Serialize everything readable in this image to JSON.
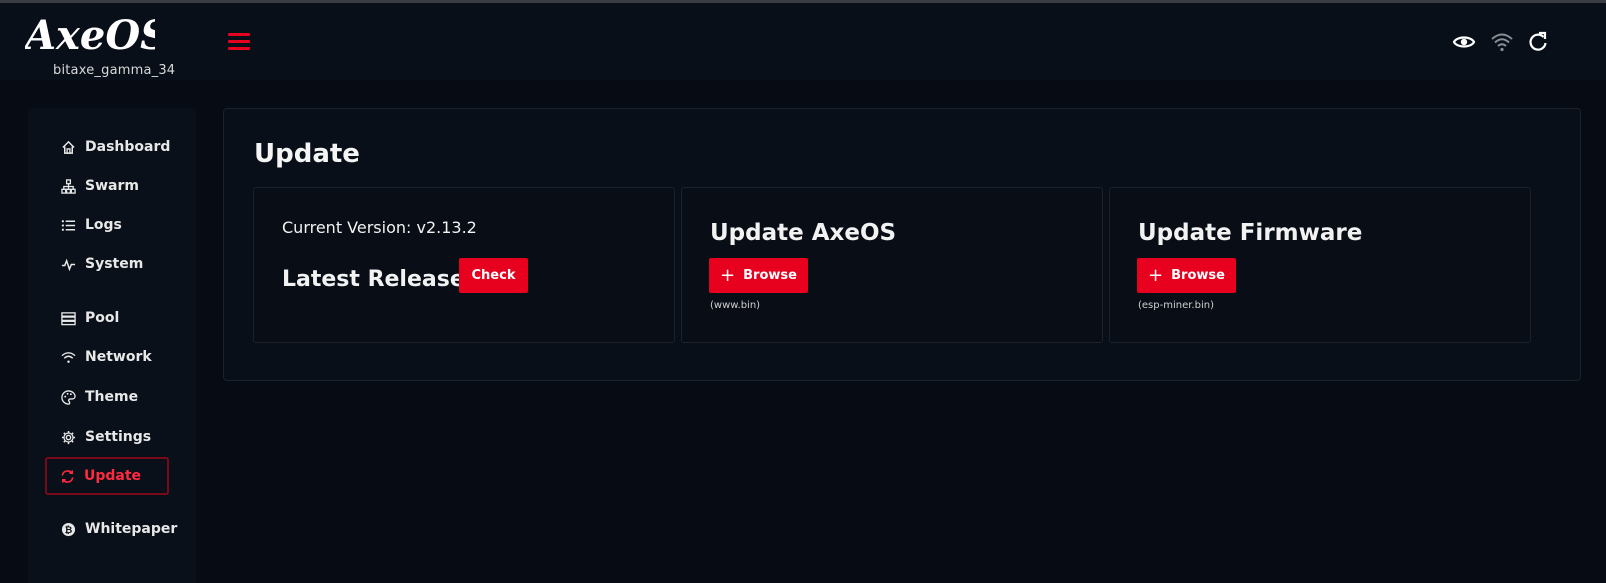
{
  "app": {
    "logo_text": "AxeOS",
    "device_name": "bitaxe_gamma_34"
  },
  "colors": {
    "accent": "#e8001f",
    "background": "#060b14",
    "card": "#090f18"
  },
  "topbar": {
    "icons": [
      "eye-icon",
      "wifi-icon",
      "refresh-icon"
    ]
  },
  "sidebar": {
    "items": [
      {
        "label": "Dashboard",
        "icon": "home-icon"
      },
      {
        "label": "Swarm",
        "icon": "sitemap-icon"
      },
      {
        "label": "Logs",
        "icon": "list-icon"
      },
      {
        "label": "System",
        "icon": "pulse-icon"
      },
      {
        "label": "Pool",
        "icon": "server-icon"
      },
      {
        "label": "Network",
        "icon": "wifi-icon"
      },
      {
        "label": "Theme",
        "icon": "palette-icon"
      },
      {
        "label": "Settings",
        "icon": "gear-icon"
      },
      {
        "label": "Update",
        "icon": "sync-icon",
        "active": true
      },
      {
        "label": "Whitepaper",
        "icon": "bitcoin-icon"
      }
    ]
  },
  "main": {
    "title": "Update",
    "version_panel": {
      "current_version": "Current Version: v2.13.2",
      "latest_release_label": "Latest Release:",
      "check_label": "Check"
    },
    "axeos_panel": {
      "title": "Update AxeOS",
      "browse_label": "Browse",
      "file_hint": "(www.bin)"
    },
    "firmware_panel": {
      "title": "Update Firmware",
      "browse_label": "Browse",
      "file_hint": "(esp-miner.bin)"
    }
  }
}
